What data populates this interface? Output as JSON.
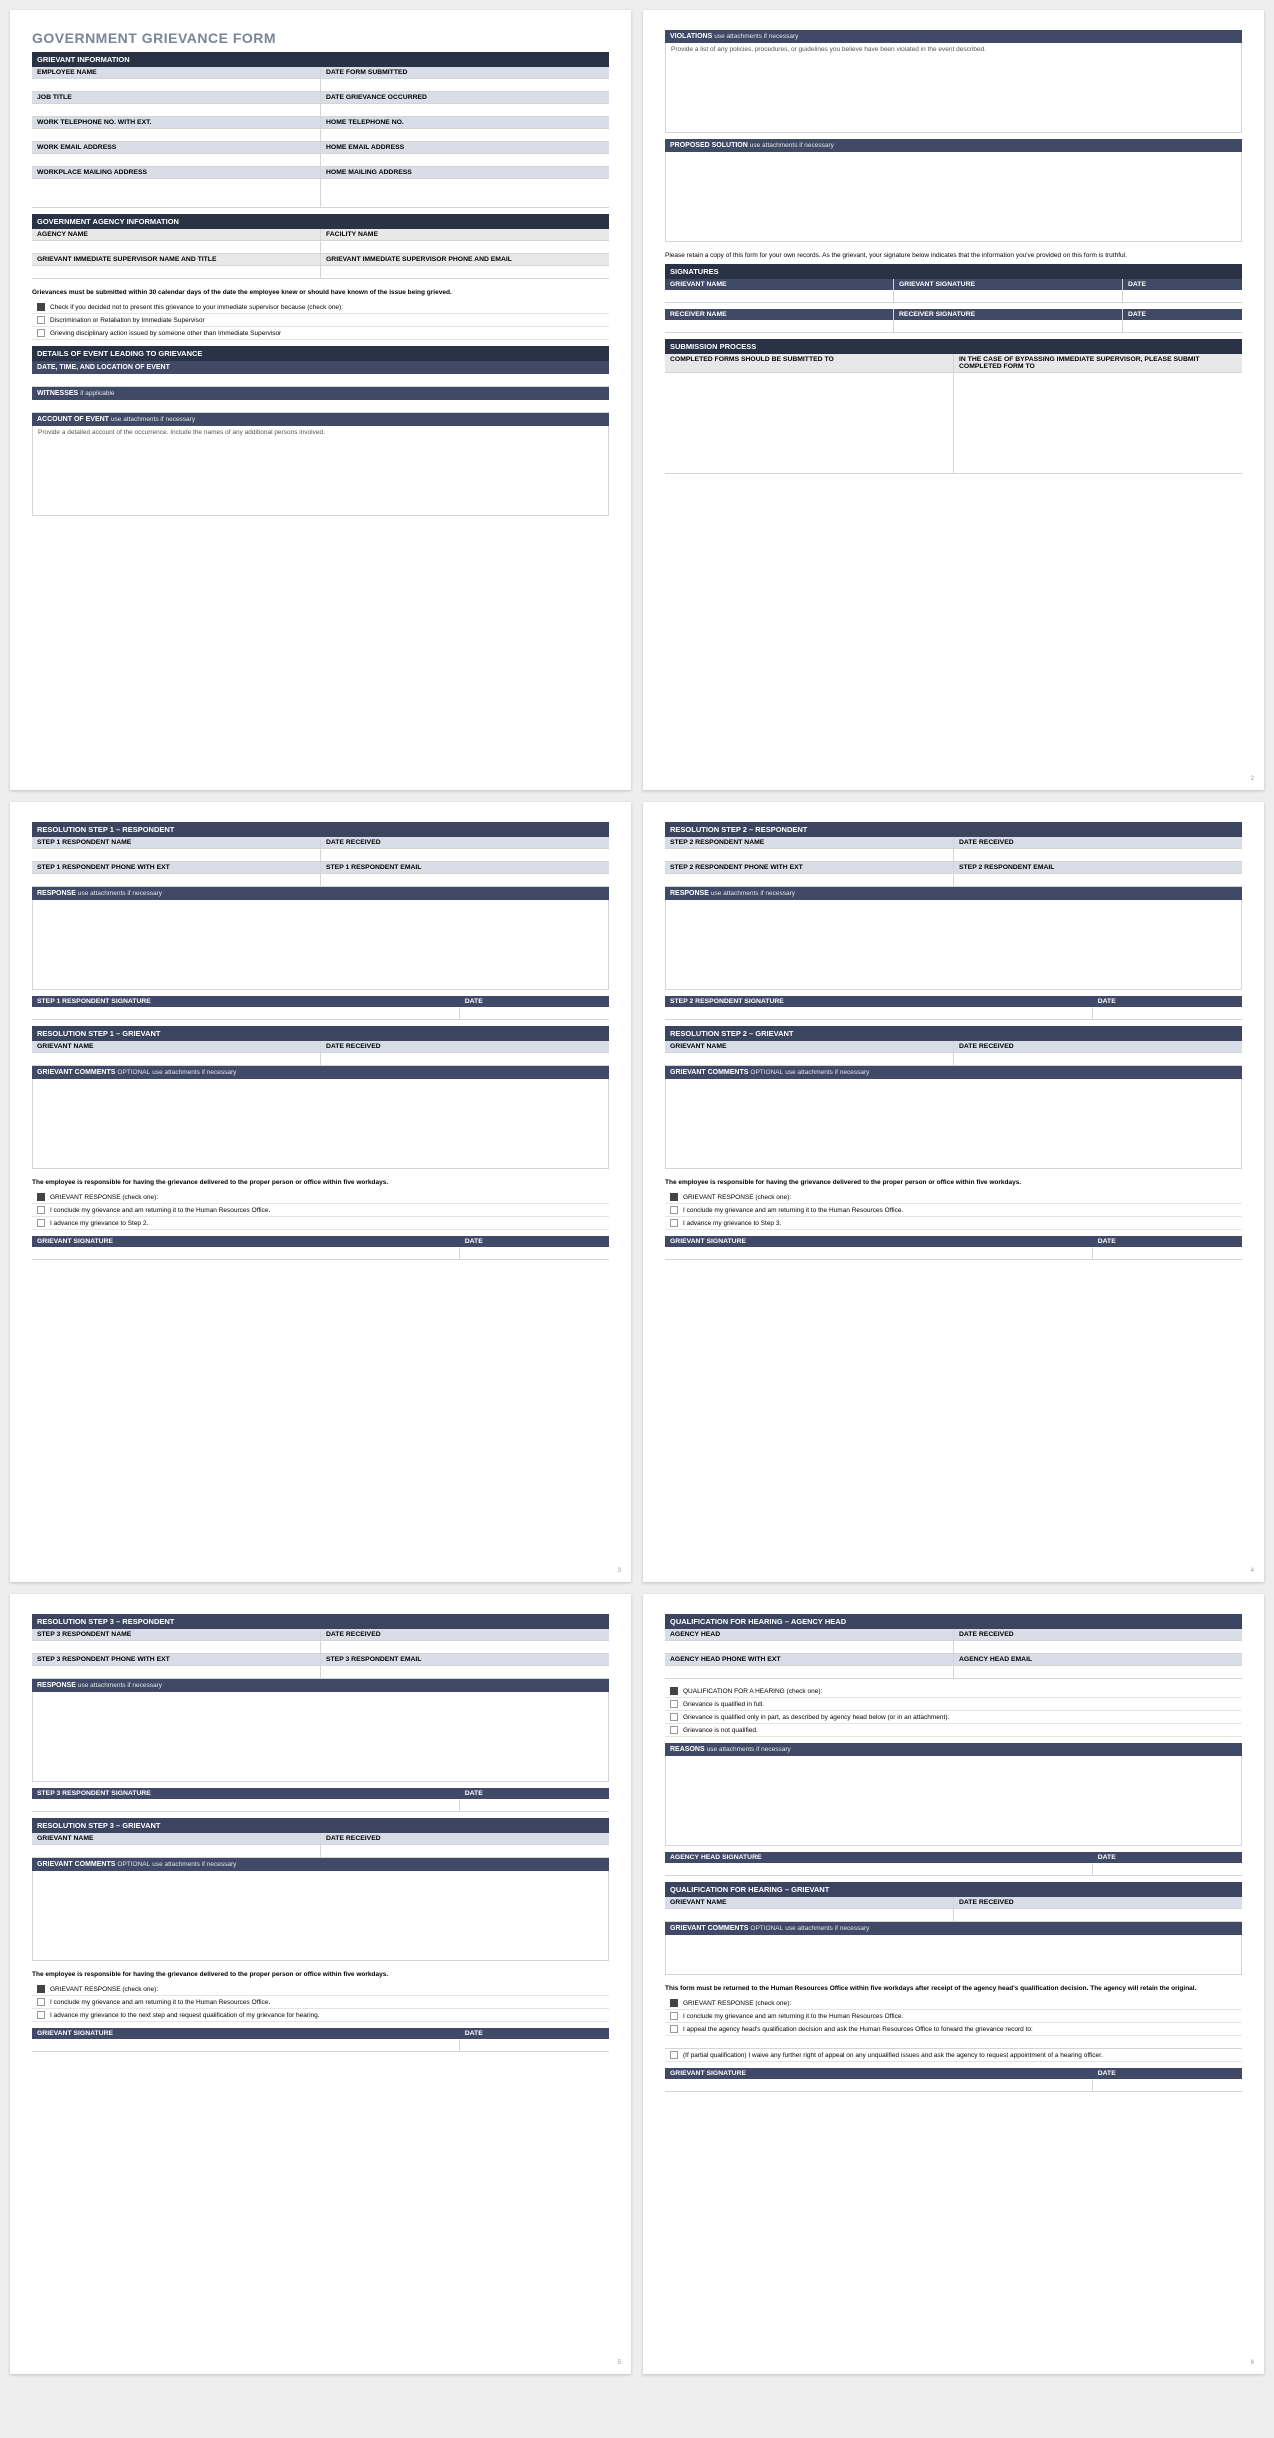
{
  "title": "GOVERNMENT GRIEVANCE FORM",
  "p1": {
    "s1": "GRIEVANT INFORMATION",
    "f": [
      "EMPLOYEE NAME",
      "DATE FORM SUBMITTED",
      "JOB TITLE",
      "DATE GRIEVANCE OCCURRED",
      "WORK TELEPHONE NO. with EXT.",
      "HOME TELEPHONE NO.",
      "WORK EMAIL ADDRESS",
      "HOME EMAIL ADDRESS",
      "WORKPLACE MAILING ADDRESS",
      "HOME MAILING ADDRESS"
    ],
    "s2": "GOVERNMENT AGENCY INFORMATION",
    "g": [
      "AGENCY NAME",
      "FACILITY NAME",
      "GRIEVANT IMMEDIATE SUPERVISOR NAME AND TITLE",
      "GRIEVANT IMMEDIATE SUPERVISOR PHONE AND EMAIL"
    ],
    "n1": "Grievances must be submitted within 30 calendar days of the date the employee knew or should have known of the issue being grieved.",
    "c0": "Check if you decided not to present this grievance to your immediate supervisor because (check one):",
    "c1": "Discrimination or Retaliation by Immediate Supervisor",
    "c2": "Grieving disciplinary action issued by someone other than Immediate Supervisor",
    "s3": "DETAILS OF EVENT LEADING TO GRIEVANCE",
    "d1": "DATE, TIME, AND LOCATION OF EVENT",
    "d2": "WITNESSES",
    "d2b": "if applicable",
    "d3": "ACCOUNT OF EVENT",
    "d3b": "use attachments if necessary",
    "d3t": "Provide a detailed account of the occurrence.  Include the names of any additional persons involved."
  },
  "p2": {
    "v": "VIOLATIONS",
    "vb": "use attachments if necessary",
    "vt": "Provide a list of any policies, procedures, or guidelines you believe have been violated in the event described.",
    "ps": "PROPOSED SOLUTION",
    "psb": "use attachments if necessary",
    "n": "Please retain a copy of this form for your own records.  As the grievant, your signature below indicates that the information you've provided on this form is truthful.",
    "sg": "SIGNATURES",
    "sr": [
      "GRIEVANT NAME",
      "GRIEVANT SIGNATURE",
      "DATE",
      "RECEIVER NAME",
      "RECEIVER SIGNATURE",
      "DATE"
    ],
    "sp": "SUBMISSION PROCESS",
    "sp1": "COMPLETED FORMS SHOULD BE SUBMITTED TO",
    "sp2": "IN THE CASE OF BYPASSING IMMEDIATE SUPERVISOR, PLEASE SUBMIT COMPLETED FORM TO"
  },
  "r": {
    "resp": "RESPONDENT",
    "griev": "GRIEVANT",
    "date": "DATE",
    "dr": "DATE RECEIVED",
    "rsp": "RESPONSE",
    "rspb": "use attachments if necessary",
    "gc": "GRIEVANT COMMENTS",
    "gco": "OPTIONAL",
    "gcb": "use attachments if necessary",
    "gn": "GRIEVANT NAME",
    "gs": "GRIEVANT SIGNATURE",
    "emp": "The employee is responsible for having the grievance delivered to the proper person or office within five workdays.",
    "gr": "GRIEVANT RESPONSE (check one):",
    "opt1": "I conclude my grievance and am returning it to the Human Resources Office.",
    "opt2a": "I advance my grievance to Step 2.",
    "opt2b": "I advance my grievance to Step 3.",
    "opt2c": "I advance my grievance to the next step and request qualification of my grievance for hearing."
  },
  "s": [
    {
      "h": "RESOLUTION STEP 1",
      "n": "STEP 1 RESPONDENT NAME",
      "p": "STEP 1 RESPONDENT PHONE with EXT",
      "e": "STEP 1 RESPONDENT EMAIL",
      "sg": "STEP 1 RESPONDENT SIGNATURE",
      "hg": "RESOLUTION STEP 1  –  GRIEVANT"
    },
    {
      "h": "RESOLUTION STEP 2",
      "n": "STEP 2 RESPONDENT NAME",
      "p": "STEP 2 RESPONDENT PHONE with EXT",
      "e": "STEP 2 RESPONDENT EMAIL",
      "sg": "STEP 2 RESPONDENT SIGNATURE",
      "hg": "RESOLUTION STEP 2  –  GRIEVANT"
    },
    {
      "h": "RESOLUTION STEP 3",
      "n": "STEP 3 RESPONDENT NAME",
      "p": "STEP 3 RESPONDENT PHONE with EXT",
      "e": "STEP 3 RESPONDENT EMAIL",
      "sg": "STEP 3 RESPONDENT SIGNATURE",
      "hg": "RESOLUTION STEP 3  –  GRIEVANT"
    }
  ],
  "p6": {
    "h1": "QUALIFICATION FOR HEARING  –  AGENCY HEAD",
    "ah": "AGENCY HEAD",
    "ahp": "AGENCY HEAD PHONE with EXT",
    "ahe": "AGENCY HEAD EMAIL",
    "q": "QUALIFICATION FOR A HEARING (check one):",
    "q1": "Grievance is qualified in full.",
    "q2": "Grievance is qualified only in part, as described by agency head below (or in an attachment).",
    "q3": "Grievance is not qualified.",
    "rs": "REASONS",
    "rsb": "use attachments if necessary",
    "ahs": "AGENCY HEAD SIGNATURE",
    "h2": "QUALIFICATION FOR HEARING  –  GRIEVANT",
    "n": "This form must be returned to the Human Resources Office within five workdays after receipt of the agency head's qualification decision. The agency will retain the original.",
    "o1": "I conclude my grievance and am returning it to the Human Resources Office.",
    "o2": "I appeal the agency head's qualification decision and ask the Human Resources Office to forward the grievance record to:",
    "o3": "(If partial qualification) I waive any further right of appeal on any unqualified issues and ask the agency to request appointment of a hearing officer."
  }
}
